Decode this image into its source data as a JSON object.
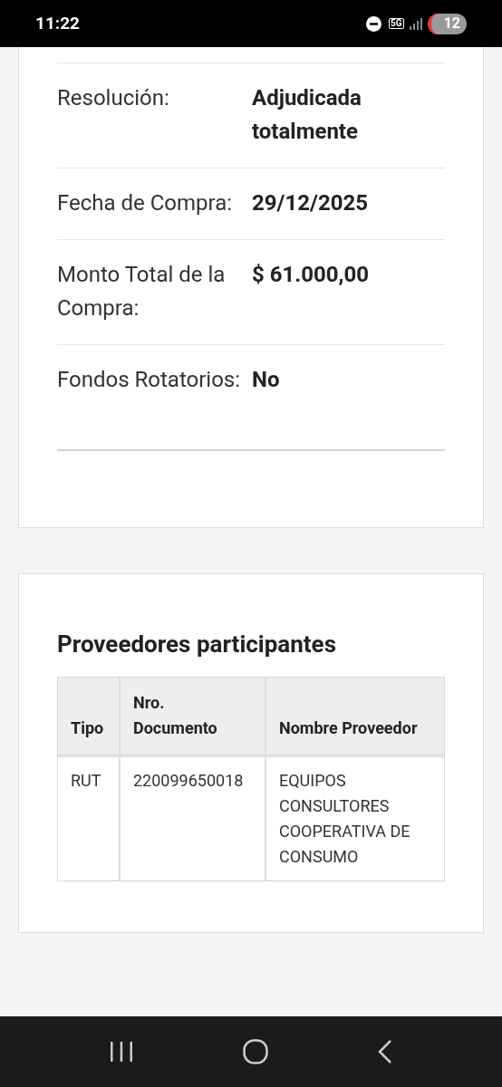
{
  "status_bar": {
    "time": "11:22",
    "network": "5G",
    "battery": "12"
  },
  "details": [
    {
      "label": "Resolución:",
      "value": "Adjudicada totalmente"
    },
    {
      "label": "Fecha de Compra:",
      "value": "29/12/2025"
    },
    {
      "label": "Monto Total de la Compra:",
      "value": "$ 61.000,00"
    },
    {
      "label": "Fondos Rotatorios:",
      "value": "No"
    }
  ],
  "suppliers": {
    "title": "Proveedores participantes",
    "columns": [
      "Tipo",
      "Nro. Documento",
      "Nombre Proveedor"
    ],
    "rows": [
      [
        "RUT",
        "220099650018",
        "EQUIPOS CONSULTORES COOPERATIVA DE CONSUMO"
      ]
    ]
  }
}
